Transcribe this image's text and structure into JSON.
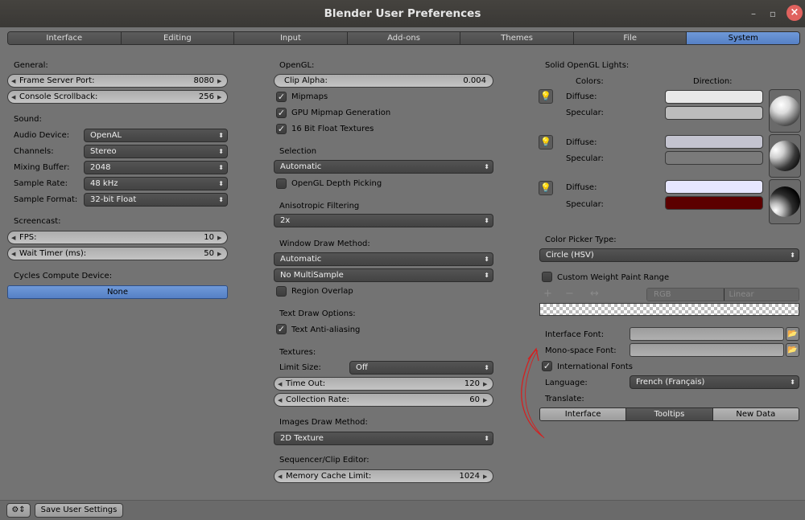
{
  "window": {
    "title": "Blender User Preferences",
    "min_icon": "minimize-icon",
    "max_icon": "maximize-icon",
    "close_icon": "close-icon",
    "close_glyph": "×",
    "min_glyph": "–",
    "max_glyph": "▫"
  },
  "tabs": [
    "Interface",
    "Editing",
    "Input",
    "Add-ons",
    "Themes",
    "File",
    "System"
  ],
  "active_tab": "System",
  "general": {
    "heading": "General:",
    "frame_server_port": {
      "label": "Frame Server Port:",
      "value": "8080"
    },
    "console_scrollback": {
      "label": "Console Scrollback:",
      "value": "256"
    }
  },
  "sound": {
    "heading": "Sound:",
    "audio_device": {
      "label": "Audio Device:",
      "value": "OpenAL"
    },
    "channels": {
      "label": "Channels:",
      "value": "Stereo"
    },
    "mixing_buffer": {
      "label": "Mixing Buffer:",
      "value": "2048"
    },
    "sample_rate": {
      "label": "Sample Rate:",
      "value": "48 kHz"
    },
    "sample_format": {
      "label": "Sample Format:",
      "value": "32-bit Float"
    }
  },
  "screencast": {
    "heading": "Screencast:",
    "fps": {
      "label": "FPS:",
      "value": "10"
    },
    "wait_timer": {
      "label": "Wait Timer (ms):",
      "value": "50"
    }
  },
  "cycles": {
    "heading": "Cycles Compute Device:",
    "value": "None"
  },
  "opengl": {
    "heading": "OpenGL:",
    "clip_alpha": {
      "label": "Clip Alpha:",
      "value": "0.004"
    },
    "mipmaps": {
      "label": "Mipmaps",
      "checked": true
    },
    "gpu_mipmap": {
      "label": "GPU Mipmap Generation",
      "checked": true
    },
    "float_textures": {
      "label": "16 Bit Float Textures",
      "checked": true
    }
  },
  "selection": {
    "heading": "Selection",
    "value": "Automatic",
    "depth_picking": {
      "label": "OpenGL Depth Picking",
      "checked": false
    }
  },
  "anisotropic": {
    "heading": "Anisotropic Filtering",
    "value": "2x"
  },
  "window_draw": {
    "heading": "Window Draw Method:",
    "method": "Automatic",
    "multisample": "No MultiSample",
    "region_overlap": {
      "label": "Region Overlap",
      "checked": false
    }
  },
  "text_draw": {
    "heading": "Text Draw Options:",
    "antialiasing": {
      "label": "Text Anti-aliasing",
      "checked": true
    }
  },
  "textures": {
    "heading": "Textures:",
    "limit_size": {
      "label": "Limit Size:",
      "value": "Off"
    },
    "time_out": {
      "label": "Time Out:",
      "value": "120"
    },
    "collection_rate": {
      "label": "Collection Rate:",
      "value": "60"
    }
  },
  "images_draw": {
    "heading": "Images Draw Method:",
    "value": "2D Texture"
  },
  "sequencer": {
    "heading": "Sequencer/Clip Editor:",
    "memory_cache": {
      "label": "Memory Cache Limit:",
      "value": "1024"
    }
  },
  "solid_lights": {
    "heading": "Solid OpenGL Lights:",
    "colors_label": "Colors:",
    "direction_label": "Direction:",
    "diffuse_label": "Diffuse:",
    "specular_label": "Specular:",
    "lights": [
      {
        "diffuse": "#e8e8e8",
        "specular": "#bcbcbc"
      },
      {
        "diffuse": "#c4c4d0",
        "specular": "#7a7a7a"
      },
      {
        "diffuse": "#e6e6ff",
        "specular": "#5c0000"
      }
    ]
  },
  "color_picker": {
    "heading": "Color Picker Type:",
    "value": "Circle (HSV)"
  },
  "weight_paint": {
    "label": "Custom Weight Paint Range",
    "checked": false,
    "plus": "+",
    "minus": "−",
    "flip": "↔",
    "mode": "RGB",
    "interp": "Linear"
  },
  "fonts": {
    "interface_label": "Interface Font:",
    "mono_label": "Mono-space Font:",
    "interface_value": "",
    "mono_value": ""
  },
  "international": {
    "label": "International Fonts",
    "checked": true
  },
  "language": {
    "label": "Language:",
    "value": "French (Français)"
  },
  "translate": {
    "label": "Translate:",
    "buttons": [
      "Interface",
      "Tooltips",
      "New Data"
    ]
  },
  "footer": {
    "save_label": "Save User Settings"
  },
  "colors": {
    "accent": "#5b86cc",
    "annotation": "#d42020"
  }
}
